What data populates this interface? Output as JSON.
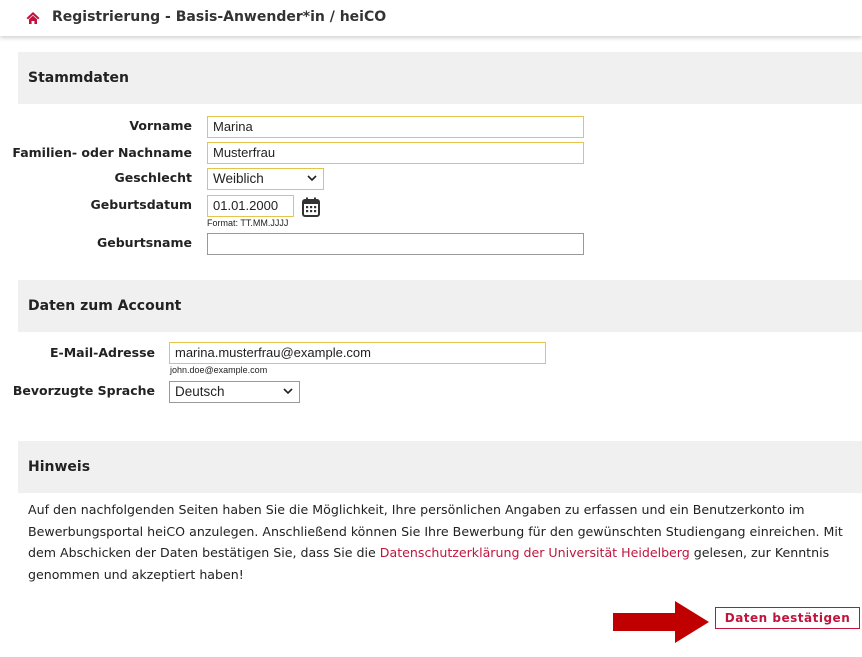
{
  "header": {
    "title": "Registrierung - Basis-Anwender*in  / heiCO",
    "home_icon": "home-icon"
  },
  "stammdaten": {
    "heading": "Stammdaten",
    "vorname_label": "Vorname",
    "vorname_value": "Marina",
    "nachname_label": "Familien- oder Nachname",
    "nachname_value": "Musterfrau",
    "geschlecht_label": "Geschlecht",
    "geschlecht_value": "Weiblich",
    "geburtsdatum_label": "Geburtsdatum",
    "geburtsdatum_value": "01.01.2000",
    "geburtsdatum_hint": "Format: TT.MM.JJJJ",
    "geburtsname_label": "Geburtsname",
    "geburtsname_value": ""
  },
  "account": {
    "heading": "Daten zum Account",
    "email_label": "E-Mail-Adresse",
    "email_value": "marina.musterfrau@example.com",
    "email_hint": "john.doe@example.com",
    "sprache_label": "Bevorzugte Sprache",
    "sprache_value": "Deutsch"
  },
  "hinweis": {
    "heading": "Hinweis",
    "text_before_link": "Auf den nachfolgenden Seiten haben Sie die Möglichkeit, Ihre persönlichen Angaben zu erfassen und ein Benutzerkonto im Bewerbungsportal heiCO anzulegen. Anschließend können Sie Ihre Bewerbung für den gewünschten Studiengang einreichen. Mit dem Abschicken der Daten bestätigen Sie, dass Sie die ",
    "link_text": "Datenschutzerklärung der Universität Heidelberg",
    "text_after_link": " gelesen, zur Kenntnis genommen und akzeptiert haben!"
  },
  "actions": {
    "submit_label": "Daten bestätigen"
  },
  "colors": {
    "accent": "#c0143c",
    "arrow": "#c00000",
    "field_border": "#e6c34a",
    "section_bg": "#f0f0f0"
  }
}
